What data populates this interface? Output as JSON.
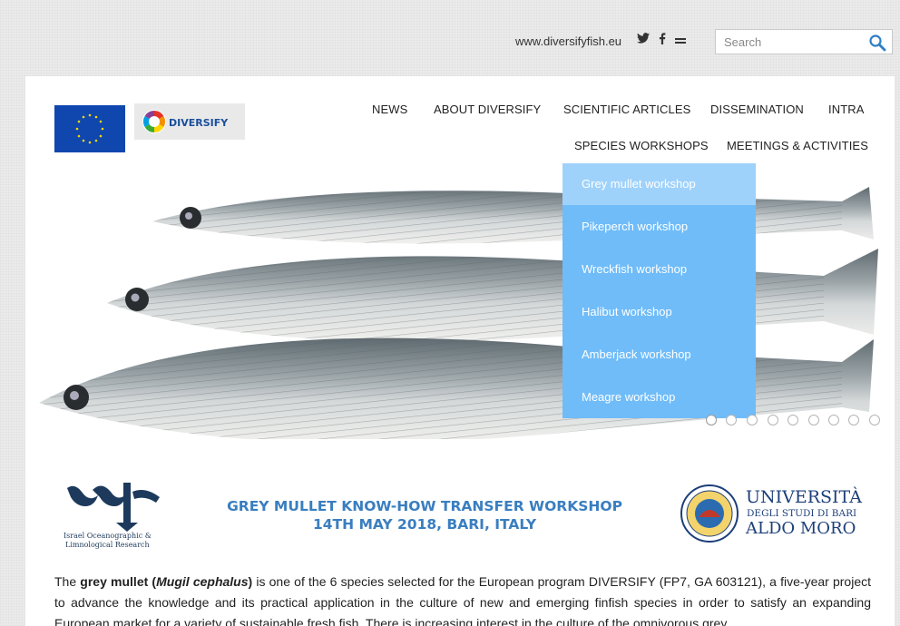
{
  "topbar": {
    "site_url": "www.diversifyfish.eu",
    "social_icons": [
      "twitter-icon",
      "facebook-icon",
      "email-icon"
    ],
    "search_placeholder": "Search"
  },
  "logos": {
    "diversify_text": "DIVERSIFY",
    "iolr_line1": "Israel Oceanographic &",
    "iolr_line2": "Limnological Research",
    "uniba_line1": "UNIVERSITÀ",
    "uniba_line2": "DEGLI STUDI DI BARI",
    "uniba_line3": "ALDO MORO"
  },
  "nav": {
    "row1": [
      "NEWS",
      "ABOUT DIVERSIFY",
      "SCIENTIFIC ARTICLES",
      "DISSEMINATION",
      "INTRA"
    ],
    "row2": [
      "SPECIES WORKSHOPS",
      "MEETINGS & ACTIVITIES"
    ]
  },
  "dropdown": {
    "items": [
      "Grey mullet workshop",
      "Pikeperch workshop",
      "Wreckfish workshop",
      "Halibut workshop",
      "Amberjack workshop",
      "Meagre workshop"
    ],
    "active_index": 0
  },
  "slider": {
    "dot_count": 9,
    "active_index": 0
  },
  "workshop": {
    "title_line1": "GREY MULLET KNOW-HOW TRANSFER WORKSHOP",
    "title_line2": "14TH MAY 2018, BARI, ITALY"
  },
  "intro": {
    "p1": "The ",
    "bold1": "grey mullet (",
    "italic": "Mugil cephalus",
    "bold2": ")",
    "p2": " is one of the 6 species selected for the European program DIVERSIFY (FP7, GA 603121), a five-year project to advance the knowledge and its practical application in the culture of new and emerging finfish species in order to satisfy an expanding European market for a variety of sustainable fresh fish. There is increasing interest in the culture of the omnivorous grey"
  },
  "colors": {
    "dropdown_bg": "#6fbcf9",
    "dropdown_active": "#9fd2fb",
    "title_blue": "#3a7ec0",
    "eu_blue": "#0f47af",
    "search_icon": "#2f7fc6"
  }
}
